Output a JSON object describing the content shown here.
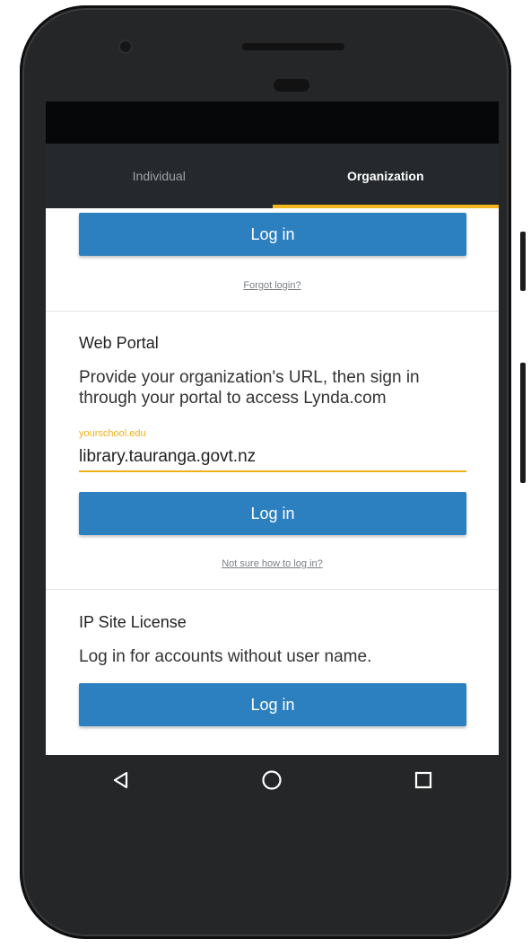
{
  "tabs": [
    {
      "label": "Individual",
      "active": false
    },
    {
      "label": "Organization",
      "active": true
    }
  ],
  "colors": {
    "accent": "#f3b61f",
    "button": "#2d80c0",
    "tab_bar": "#25292d"
  },
  "sso": {
    "login_label": "Log in",
    "forgot_link": "Forgot login?"
  },
  "web_portal": {
    "title": "Web Portal",
    "description": "Provide your organization's URL, then sign in through your portal to access Lynda.com",
    "field_label": "yourschool.edu",
    "field_value": "library.tauranga.govt.nz",
    "login_label": "Log in",
    "help_link": "Not sure how to log in?"
  },
  "ip_license": {
    "title": "IP Site License",
    "description": "Log in for accounts without user name.",
    "login_label": "Log in"
  },
  "nav": {
    "icons": [
      "back-icon",
      "home-icon",
      "recents-icon"
    ]
  }
}
